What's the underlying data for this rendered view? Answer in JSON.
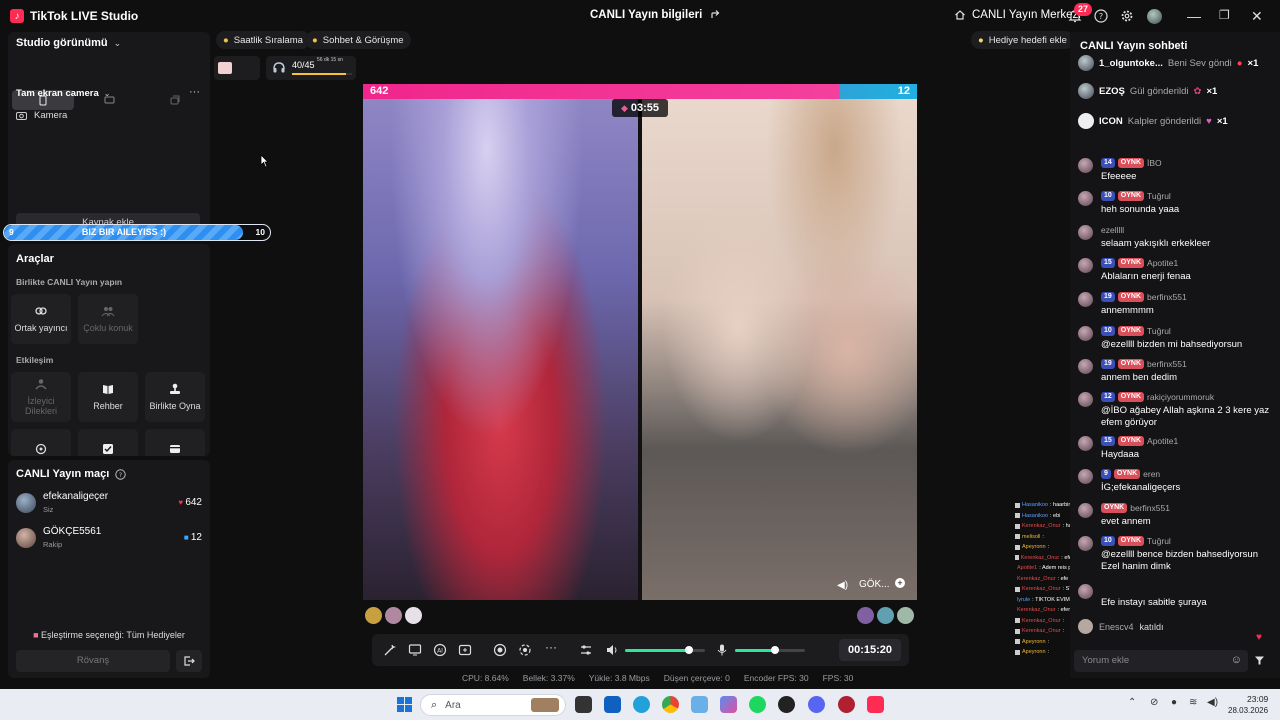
{
  "titlebar": {
    "app_title": "TikTok LIVE Studio",
    "live_info": "CANLI Yayın bilgileri",
    "live_center": "CANLI Yayın Merkezi",
    "notif_count": "27"
  },
  "left": {
    "studio_view": "Studio görünümü",
    "fullscreen_camera": "Tam ekran camera",
    "camera_source": "Kamera",
    "add_source": "Kaynak ekle",
    "aile_bar": {
      "left": "9",
      "label": "BIZ BIR AILEYISS :)",
      "right": "10",
      "progress": 0.9
    },
    "tools_title": "Araçlar",
    "together_title": "Birlikte CANLI Yayın yapın",
    "tool_cohost": "Ortak yayıncı",
    "tool_multiguest": "Çoklu konuk",
    "interaction_title": "Etkileşim",
    "tool_viewer_requests": "İzleyici Dilekleri",
    "tool_guide": "Rehber",
    "tool_play_together": "Birlikte Oyna",
    "match_title": "CANLI Yayın maçı",
    "match_rows": [
      {
        "name": "efekanaligeçer",
        "sub": "Siz",
        "score": "642"
      },
      {
        "name": "GÖKÇE5561",
        "sub": "Rakip",
        "score": "12"
      }
    ],
    "matching_option": "Eşleştirme seçeneği: Tüm Hediyeler",
    "rematch": "Rövanş"
  },
  "center": {
    "chip_hourly": "Saatlik Sıralama",
    "chip_chat_meet": "Sohbet & Görüşme",
    "gift_goal": "Hediye hedefi ekle",
    "goal_progress": "40/45",
    "goal_time": "56 dk 15 sn",
    "score_left": "642",
    "score_right": "12",
    "timer": "03:55",
    "opponent_label": "GÖK...",
    "elapsed": "00:15:20",
    "stats": {
      "cpu": "CPU: 8.64%",
      "mem": "Bellek: 3.37%",
      "upload": "Yükle: 3.8 Mbps",
      "dropped": "Düşen çerçeve: 0",
      "encoder_fps": "Encoder FPS: 30",
      "fps": "FPS: 30"
    }
  },
  "chat": {
    "title": "CANLI Yayın sohbeti",
    "gifts": [
      {
        "user": "1_olguntoke...",
        "text": "Beni Sev göndi",
        "count": "×1"
      },
      {
        "user": "EZOŞ",
        "text": "Gül gönderildi",
        "count": "×1"
      },
      {
        "user": "ICON",
        "text": "Kalpler gönderildi",
        "count": "×1"
      }
    ],
    "messages": [
      {
        "lvl": "14",
        "tag": "OYNK",
        "user": "İBO",
        "text": "Efeeeee"
      },
      {
        "lvl": "10",
        "tag": "OYNK",
        "user": "Tuğrul",
        "text": "heh sonunda yaaa"
      },
      {
        "lvl": "",
        "tag": "",
        "user": "ezelllll",
        "text": "selaam yakışıklı erkekleer"
      },
      {
        "lvl": "15",
        "tag": "OYNK",
        "user": "Apotite1",
        "text": "Ablaların enerji fenaa"
      },
      {
        "lvl": "19",
        "tag": "OYNK",
        "user": "berfinx551",
        "text": "annemmmm"
      },
      {
        "lvl": "10",
        "tag": "OYNK",
        "user": "Tuğrul",
        "text": "@ezellll bizden mi bahsediyorsun"
      },
      {
        "lvl": "19",
        "tag": "OYNK",
        "user": "berfinx551",
        "text": "annem ben dedim"
      },
      {
        "lvl": "12",
        "tag": "OYNK",
        "user": "rakiçiyorummoruk",
        "text": "@İBO ağabey Allah aşkına 2 3 kere yaz efem görüyor"
      },
      {
        "lvl": "15",
        "tag": "OYNK",
        "user": "Apotite1",
        "text": "Haydaaa"
      },
      {
        "lvl": "9",
        "tag": "OYNK",
        "user": "eren",
        "text": "İG;efekanaligeçers"
      },
      {
        "lvl": "",
        "tag": "OYNK",
        "user": "berfinx551",
        "text": "evet annem"
      },
      {
        "lvl": "10",
        "tag": "OYNK",
        "user": "Tuğrul",
        "text": "@ezellll bence bizden bahsediyorsun Ezel hanim dimk"
      },
      {
        "lvl": "",
        "tag": "",
        "user": "",
        "text": "Efe instayı sabitle şuraya"
      }
    ],
    "join_user": "Enescv4",
    "join_text": "katıldı",
    "input_placeholder": "Yorum ekle"
  },
  "overlay_lines": [
    {
      "u": "Hasanikoo",
      "t": ": haarbim",
      "c": "blue"
    },
    {
      "u": "Hasanikoo",
      "t": ": ebi",
      "c": "blue"
    },
    {
      "u": "Kerenkaz_Onur",
      "t": ": hasanım starsın",
      "c": "red"
    },
    {
      "u": "melisoll",
      "t": ":",
      "c": "white"
    },
    {
      "u": "Apeyronn",
      "t": ":",
      "c": "yellow"
    },
    {
      "u": "Kerenkaz_Onur",
      "t": ": efem baba güzel",
      "c": "red"
    },
    {
      "u": "Apotite1",
      "t": ": Adem reis pilizde sanki ama",
      "c": "red"
    },
    {
      "u": "Kerenkaz_Onur",
      "t": ": efe baba sen yanlız değilsin",
      "c": "red"
    },
    {
      "u": "Kerenkaz_Onur",
      "t": ": STAR",
      "c": "red"
    },
    {
      "u": "lyrule",
      "t": ": TIKTOK EVIMIZ ADEM BABAMIZ",
      "c": "blue"
    },
    {
      "u": "Kerenkaz_Onur",
      "t": ": efem cok sey öğrenicem ondan",
      "c": "red"
    },
    {
      "u": "Kerenkaz_Onur",
      "t": ":",
      "c": "red"
    },
    {
      "u": "Kerenkaz_Onur",
      "t": ":",
      "c": "red"
    },
    {
      "u": "Apeyronn",
      "t": ":",
      "c": "yellow"
    },
    {
      "u": "Apeyronn",
      "t": ":",
      "c": "yellow"
    }
  ],
  "taskbar": {
    "search": "Ara",
    "time": "23:09",
    "date": "28.03.2026"
  }
}
